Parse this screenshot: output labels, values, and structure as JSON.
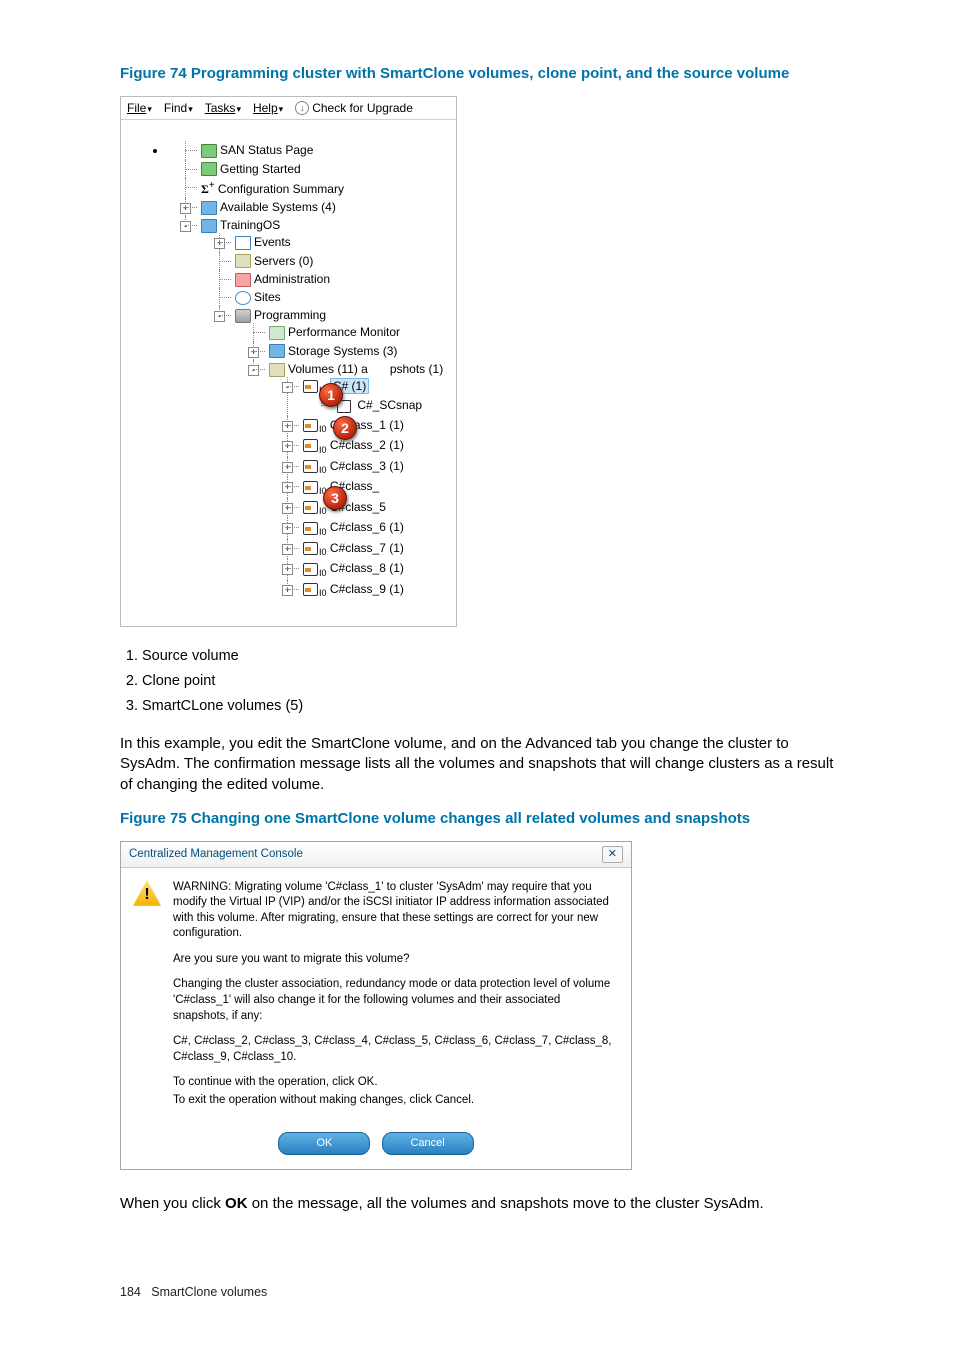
{
  "figure74": {
    "caption": "Figure 74 Programming cluster with SmartClone volumes, clone point, and the source volume",
    "menu": {
      "file": "File",
      "find": "Find",
      "tasks": "Tasks",
      "help": "Help",
      "upgrade": "Check for Upgrade"
    },
    "tree": {
      "san_status": "SAN Status Page",
      "getting_started": "Getting Started",
      "config_summary": "Configuration Summary",
      "available_systems": "Available Systems (4)",
      "training_os": "TrainingOS",
      "events": "Events",
      "servers": "Servers (0)",
      "administration": "Administration",
      "sites": "Sites",
      "programming": "Programming",
      "perf_monitor": "Performance Monitor",
      "storage_systems": "Storage Systems (3)",
      "volumes_label_a": "Volumes (11) a",
      "volumes_label_b": "pshots (1)",
      "c_sharp_1": "C# (1)",
      "c_sharp_scsnap": "C#_SCsnap",
      "cclass1": "C#class_1 (1)",
      "cclass2": "C#class_2 (1)",
      "cclass3": "C#class_3 (1)",
      "cclass4a": "C#class_",
      "cclass5": "C#class_5",
      "cclass6": "C#class_6 (1)",
      "cclass7": "C#class_7 (1)",
      "cclass8": "C#class_8 (1)",
      "cclass9": "C#class_9 (1)"
    },
    "callouts": {
      "c1": "1",
      "c2": "2",
      "c3": "3"
    }
  },
  "legend": {
    "i1": "Source volume",
    "i2": "Clone point",
    "i3": "SmartCLone volumes (5)"
  },
  "para1": "In this example, you edit the SmartClone volume, and on the Advanced tab you change the cluster to SysAdm. The confirmation message lists all the volumes and snapshots that will change clusters as a result of changing the edited volume.",
  "figure75": {
    "caption": "Figure 75 Changing one SmartClone volume changes all related volumes and snapshots",
    "dialog": {
      "title": "Centralized Management Console",
      "close": "✕",
      "warn_p1": "WARNING: Migrating volume 'C#class_1' to cluster 'SysAdm' may require that you modify the Virtual IP (VIP) and/or the iSCSI initiator IP address information associated with this volume. After migrating, ensure that these settings are correct for your new configuration.",
      "warn_p2": "Are you sure you want to migrate this volume?",
      "warn_p3": "Changing the cluster association, redundancy mode or data protection level of volume 'C#class_1' will also change it for the following volumes and their associated snapshots, if any:",
      "warn_p4": "C#, C#class_2, C#class_3, C#class_4, C#class_5, C#class_6, C#class_7, C#class_8, C#class_9, C#class_10.",
      "warn_p5": "To continue with the operation, click OK.",
      "warn_p6": "To exit the operation without making changes, click Cancel.",
      "ok": "OK",
      "cancel": "Cancel"
    }
  },
  "para2_a": "When you click ",
  "para2_b": "OK",
  "para2_c": " on the message, all the volumes and snapshots move to the cluster SysAdm.",
  "footer": {
    "page": "184",
    "section": "SmartClone volumes"
  }
}
